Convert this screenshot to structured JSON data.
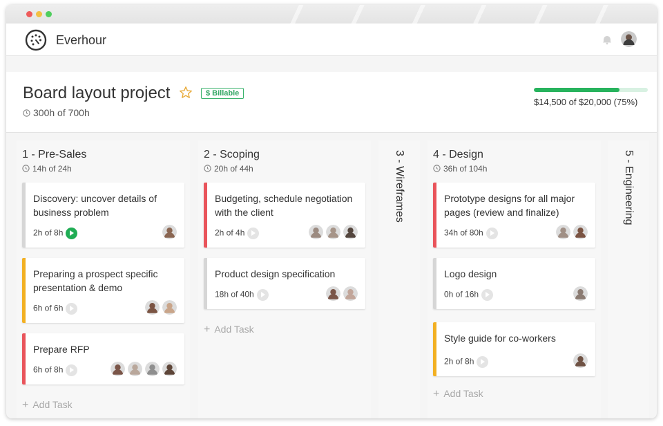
{
  "app": {
    "name": "Everhour"
  },
  "project": {
    "title": "Board layout project",
    "billable_label": "$ Billable",
    "hours_total": "300h of 700h",
    "budget_text": "$14,500 of $20,000 (75%)",
    "budget_fraction": 0.75
  },
  "columns": [
    {
      "title": "1 - Pre-Sales",
      "hours": "14h of 24h",
      "add_task": "Add Task",
      "cards": [
        {
          "title": "Discovery: uncover details of business problem",
          "hours": "2h of 8h",
          "strip": "#d6d6d6",
          "timer": "active",
          "avatars": [
            "#8a6652"
          ]
        },
        {
          "title": "Preparing a prospect specific presentation & demo",
          "hours": "6h of 6h",
          "strip": "#f2b023",
          "timer": "idle",
          "avatars": [
            "#7b5443",
            "#c9a58a"
          ]
        },
        {
          "title": "Prepare RFP",
          "hours": "6h of 8h",
          "strip": "#e9545b",
          "timer": "idle",
          "avatars": [
            "#7a5548",
            "#b9a79b",
            "#8f8f8f",
            "#5e4639"
          ]
        }
      ]
    },
    {
      "title": "2 - Scoping",
      "hours": "20h of 44h",
      "add_task": "Add Task",
      "cards": [
        {
          "title": "Budgeting, schedule negotiation with the client",
          "hours": "2h of 4h",
          "strip": "#e9545b",
          "timer": "idle",
          "avatars": [
            "#9b8a80",
            "#a69488",
            "#54463e"
          ]
        },
        {
          "title": "Product design specification",
          "hours": "18h of 40h",
          "strip": "#d6d6d6",
          "timer": "idle",
          "avatars": [
            "#7a5548",
            "#c2a69a"
          ]
        }
      ]
    },
    {
      "title": "3 - Wireframes",
      "collapsed": true
    },
    {
      "title": "4 - Design",
      "hours": "36h of 104h",
      "add_task": "Add Task",
      "cards": [
        {
          "title": "Prototype designs for all major pages (review and finalize)",
          "hours": "34h of 80h",
          "strip": "#e9545b",
          "timer": "idle",
          "avatars": [
            "#a08f85",
            "#7b5443"
          ]
        },
        {
          "title": "Logo design",
          "hours": "0h of 16h",
          "strip": "#d6d6d6",
          "timer": "idle",
          "avatars": [
            "#8b7b72"
          ]
        },
        {
          "title": "Style guide for co-workers",
          "hours": "2h of 8h",
          "strip": "#f2b023",
          "timer": "idle",
          "avatars": [
            "#6f5244"
          ]
        }
      ]
    },
    {
      "title": "5 - Engineering",
      "collapsed": true
    }
  ],
  "icons": {
    "logo": "everhour-logo-icon",
    "bell": "bell-icon",
    "star": "star-icon",
    "clock": "clock-icon",
    "play": "play-icon",
    "plus": "plus-icon"
  },
  "colors": {
    "accent_green": "#27b35d",
    "red": "#e9545b",
    "yellow": "#f2b023",
    "grey": "#d6d6d6"
  }
}
